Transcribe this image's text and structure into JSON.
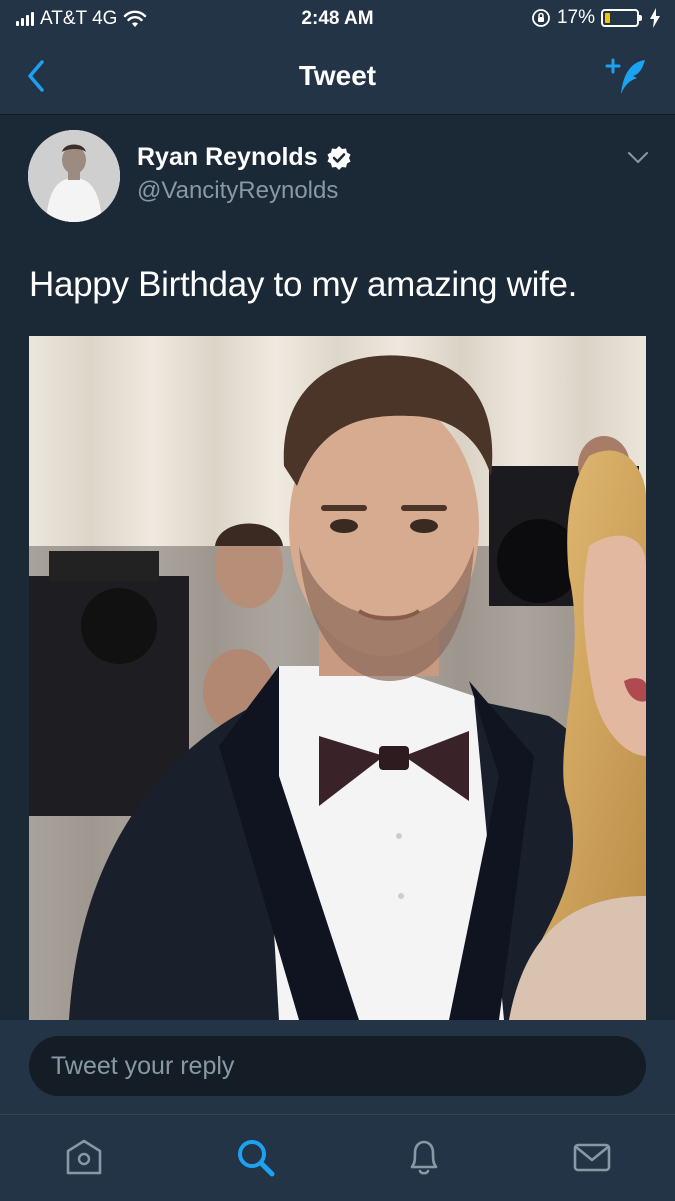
{
  "status_bar": {
    "carrier": "AT&T 4G",
    "time": "2:48 AM",
    "battery_percent": "17%",
    "battery_level": 0.17,
    "battery_color": "#f5c400"
  },
  "nav": {
    "title": "Tweet",
    "back_icon": "chevron-left-icon",
    "compose_icon": "compose-tweet-icon",
    "accent": "#1da1f2"
  },
  "tweet": {
    "author_name": "Ryan Reynolds",
    "verified": true,
    "handle": "@VancityReynolds",
    "text": "Happy Birthday to my amazing wife.",
    "media_alt": "photo",
    "menu_icon": "chevron-down-icon"
  },
  "reply": {
    "placeholder": "Tweet your reply"
  },
  "tabs": [
    {
      "name": "home",
      "icon": "home-icon",
      "active": false
    },
    {
      "name": "search",
      "icon": "search-icon",
      "active": true
    },
    {
      "name": "notifications",
      "icon": "bell-icon",
      "active": false
    },
    {
      "name": "messages",
      "icon": "mail-icon",
      "active": false
    }
  ]
}
